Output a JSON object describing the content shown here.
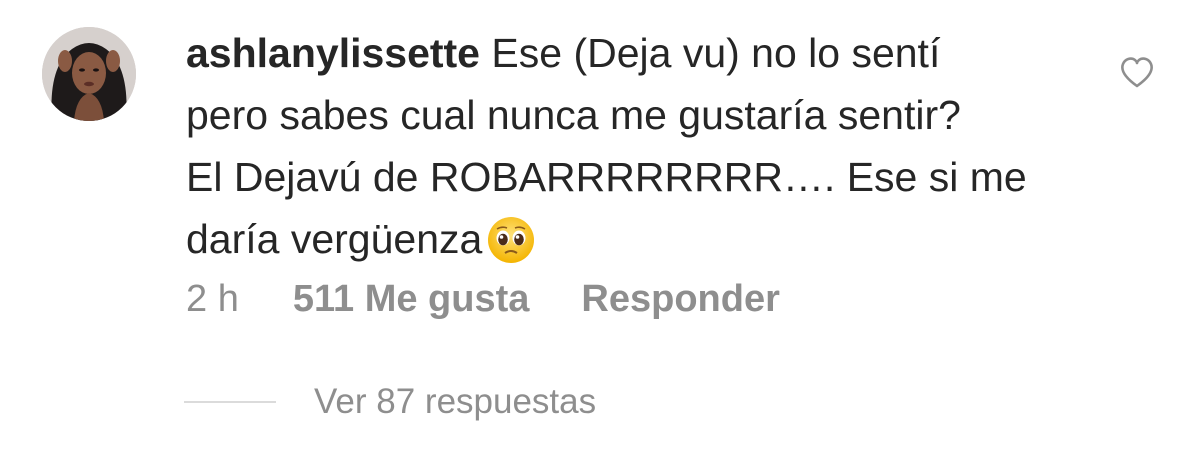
{
  "comment": {
    "username": "ashlanylissette",
    "text_line1": "Ese (Deja vu) no lo sentí",
    "text_line2": "pero sabes cual nunca me gustaría sentir?",
    "text_line3": "El Dejavú de ROBARRRRRRRR…. Ese si me",
    "text_line4": "daría vergüenza",
    "emoji": "pleading-face",
    "time": "2 h",
    "likes": "511 Me gusta",
    "reply_label": "Responder",
    "view_replies": "Ver 87 respuestas"
  },
  "icons": {
    "avatar": "profile-photo",
    "like": "heart-outline-icon"
  },
  "colors": {
    "text": "#262626",
    "secondary": "#8e8e8e",
    "divider": "#dbdbdb"
  }
}
